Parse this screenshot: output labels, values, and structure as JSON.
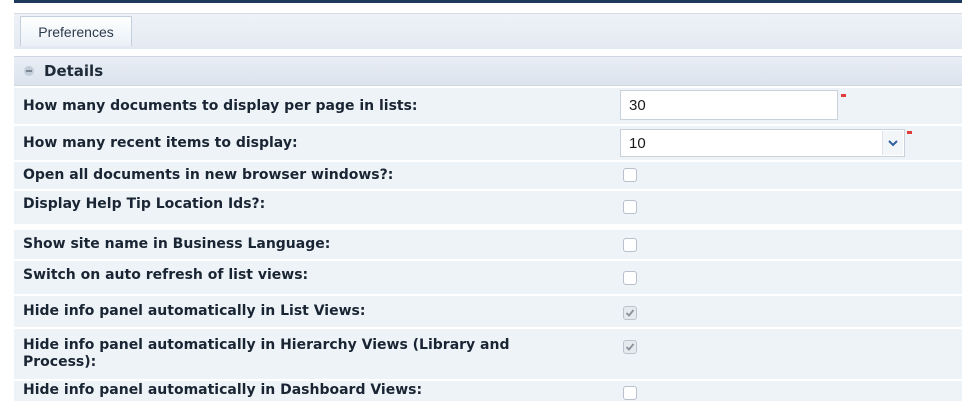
{
  "tabs": [
    {
      "label": "Preferences"
    }
  ],
  "section": {
    "title": "Details"
  },
  "fields": {
    "docs_per_page": {
      "label": "How many documents to display per page in lists:",
      "value": "30",
      "required": true
    },
    "recent_items": {
      "label": "How many recent items to display:",
      "value": "10",
      "required": true
    },
    "open_new_window": {
      "label": "Open all documents in new browser windows?:",
      "checked": false
    },
    "help_tip_ids": {
      "label": "Display Help Tip Location Ids?:",
      "checked": false
    },
    "site_name_business": {
      "label": "Show site name in Business Language:",
      "checked": false
    },
    "auto_refresh": {
      "label": "Switch on auto refresh of list views:",
      "checked": false
    },
    "hide_info_list": {
      "label": "Hide info panel automatically in List Views:",
      "checked": true
    },
    "hide_info_hierarchy": {
      "label": "Hide info panel automatically in Hierarchy Views (Library and Process):",
      "checked": true
    },
    "hide_info_dashboard": {
      "label": "Hide info panel automatically in Dashboard Views:",
      "checked": false
    }
  },
  "colors": {
    "accent": "#1d3a5c",
    "required_marker": "#e23b3b",
    "row_background": "#eef3f8"
  }
}
